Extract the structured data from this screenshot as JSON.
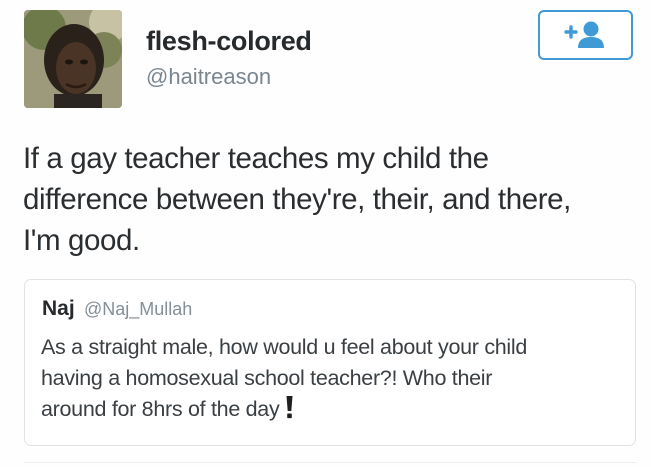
{
  "author": {
    "display_name": "flesh-colored",
    "handle": "@haitreason"
  },
  "follow_button": {
    "icon": "follow-user-plus-icon",
    "color": "#3f9ad6"
  },
  "tweet": {
    "lines": [
      "If a gay teacher teaches my child the",
      "difference between they're, their, and there,",
      "I'm good."
    ]
  },
  "quoted_tweet": {
    "display_name": "Naj",
    "handle": "@Naj_Mullah",
    "lines": [
      "As a straight male, how would u feel about your child",
      "having a homosexual school teacher?! Who their",
      "around for 8hrs of the day"
    ],
    "emoji": "exclamation-mark-emoji"
  }
}
